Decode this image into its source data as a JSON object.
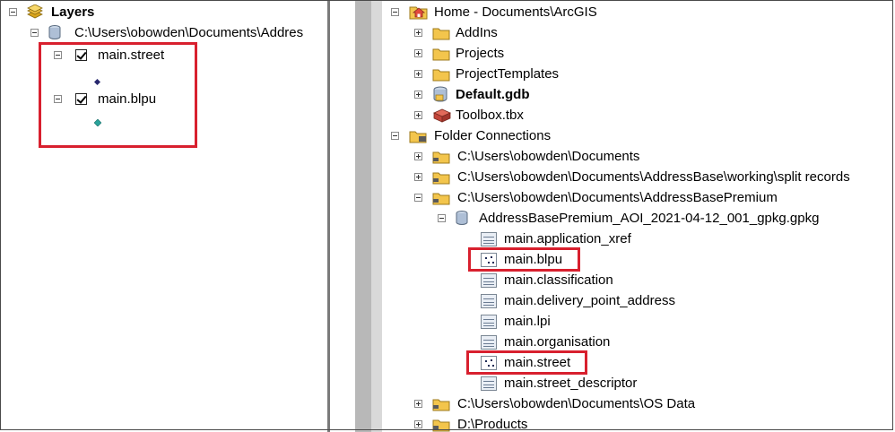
{
  "toc": {
    "root_label": "Layers",
    "db_path": "C:\\Users\\obowden\\Documents\\Addres",
    "layers": [
      {
        "label": "main.street",
        "checked": true,
        "symbol_color": "#27276e"
      },
      {
        "label": "main.blpu",
        "checked": true,
        "symbol_color": "#2aa39b"
      }
    ]
  },
  "catalog": {
    "items": [
      {
        "label": "Home - Documents\\ArcGIS",
        "expander": "minus",
        "icon": "home-folder-icon"
      },
      {
        "label": "AddIns",
        "expander": "plus",
        "icon": "folder-icon"
      },
      {
        "label": "Projects",
        "expander": "plus",
        "icon": "folder-icon"
      },
      {
        "label": "ProjectTemplates",
        "expander": "plus",
        "icon": "folder-icon"
      },
      {
        "label": "Default.gdb",
        "expander": "plus",
        "icon": "geodatabase-icon",
        "bold": true
      },
      {
        "label": "Toolbox.tbx",
        "expander": "plus",
        "icon": "toolbox-icon"
      },
      {
        "label": "Folder Connections",
        "expander": "minus",
        "icon": "folder-connections-icon"
      },
      {
        "label": "C:\\Users\\obowden\\Documents",
        "expander": "plus",
        "icon": "folder-connection-icon"
      },
      {
        "label": "C:\\Users\\obowden\\Documents\\AddressBase\\working\\split records",
        "expander": "plus",
        "icon": "folder-connection-icon"
      },
      {
        "label": "C:\\Users\\obowden\\Documents\\AddressBasePremium",
        "expander": "minus",
        "icon": "folder-connection-icon"
      },
      {
        "label": "AddressBasePremium_AOI_2021-04-12_001_gpkg.gpkg",
        "expander": "minus",
        "icon": "geopackage-icon"
      },
      {
        "label": "main.application_xref",
        "icon": "table-icon"
      },
      {
        "label": "main.blpu",
        "icon": "point-feature-class-icon",
        "highlighted": true
      },
      {
        "label": "main.classification",
        "icon": "table-icon"
      },
      {
        "label": "main.delivery_point_address",
        "icon": "table-icon"
      },
      {
        "label": "main.lpi",
        "icon": "table-icon"
      },
      {
        "label": "main.organisation",
        "icon": "table-icon"
      },
      {
        "label": "main.street",
        "icon": "point-feature-class-icon",
        "highlighted": true
      },
      {
        "label": "main.street_descriptor",
        "icon": "table-icon"
      },
      {
        "label": "C:\\Users\\obowden\\Documents\\OS Data",
        "expander": "plus",
        "icon": "folder-connection-icon"
      },
      {
        "label": "D:\\Products",
        "expander": "plus",
        "icon": "folder-connection-icon"
      }
    ]
  },
  "colors": {
    "highlight_border": "#d8202e",
    "folder_fill": "#f3c54c"
  }
}
